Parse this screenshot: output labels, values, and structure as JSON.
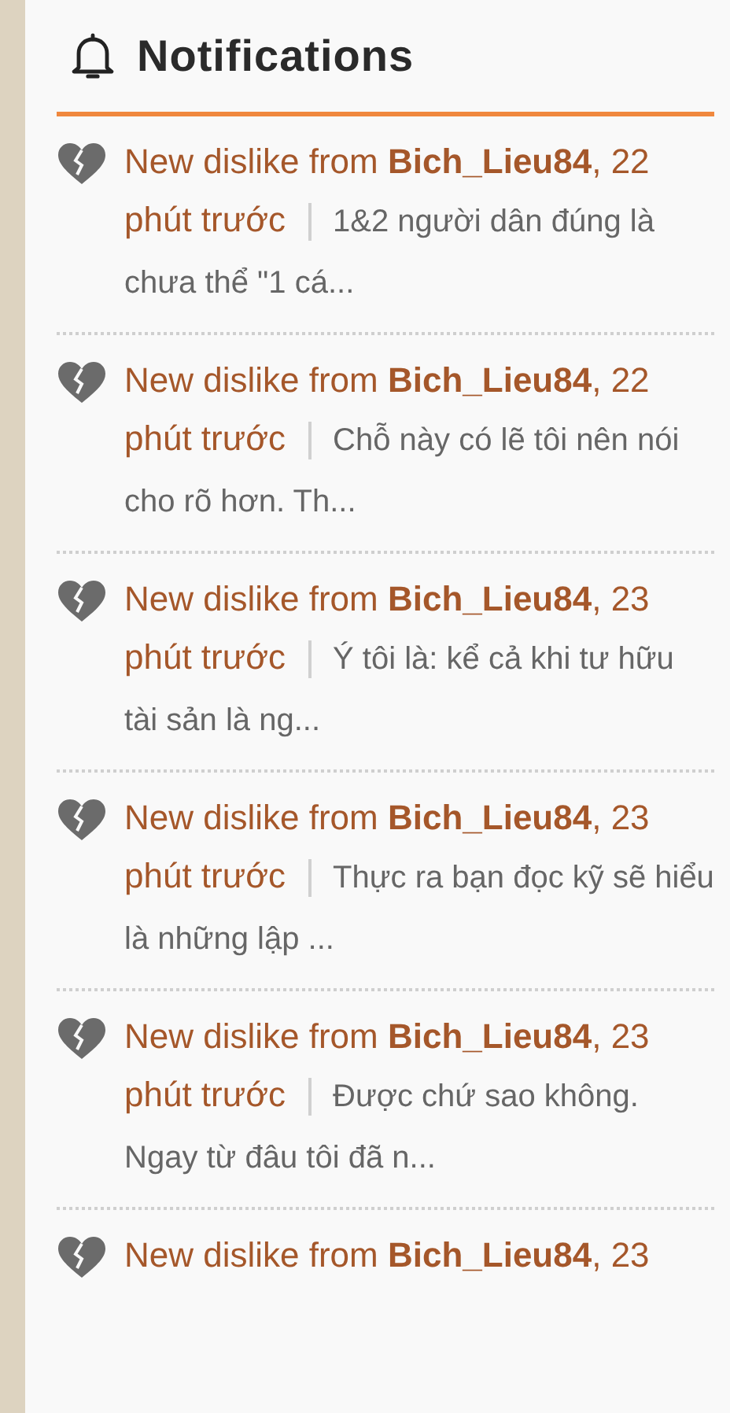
{
  "panel": {
    "title": "Notifications"
  },
  "notifications": [
    {
      "kind": "dislike",
      "title": "New dislike from **Bich_Lieu84**, 22 phút trước",
      "excerpt": "1&2 người dân đúng là chưa thể \"1 cá..."
    },
    {
      "kind": "dislike",
      "title": "New dislike from **Bich_Lieu84**, 22 phút trước",
      "excerpt": "Chỗ này có lẽ tôi nên nói cho rõ hơn. Th..."
    },
    {
      "kind": "dislike",
      "title": "New dislike from **Bich_Lieu84**, 23 phút trước",
      "excerpt": "Ý tôi là: kể cả khi tư hữu tài sản là ng..."
    },
    {
      "kind": "dislike",
      "title": "New dislike from **Bich_Lieu84**, 23 phút trước",
      "excerpt": "Thực ra bạn đọc kỹ sẽ hiểu là những lập ..."
    },
    {
      "kind": "dislike",
      "title": "New dislike from **Bich_Lieu84**, 23 phút trước",
      "excerpt": "Được chứ sao không. Ngay từ đâu tôi đã n..."
    },
    {
      "kind": "dislike",
      "title": "New dislike from **Bich_Lieu84**, 23"
    }
  ]
}
